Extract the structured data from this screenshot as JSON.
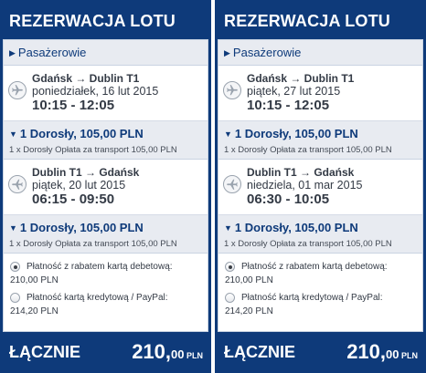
{
  "panels": [
    {
      "header": "REZERWACJA LOTU",
      "passengers_label": "Pasażerowie",
      "outbound": {
        "route": "Gdańsk → Dublin T1",
        "date": "poniedziałek, 16 lut 2015",
        "times": "10:15 - 12:05",
        "fare": "1 Dorosły, 105,00 PLN",
        "fare_detail": "1 x Dorosły Opłata za transport 105,00 PLN"
      },
      "inbound": {
        "route": "Dublin T1 → Gdańsk",
        "date": "piątek, 20 lut 2015",
        "times": "06:15 - 09:50",
        "fare": "1 Dorosły, 105,00 PLN",
        "fare_detail": "1 x Dorosły Opłata za transport 105,00 PLN"
      },
      "payments": [
        {
          "label": "Płatność z rabatem kartą debetową:",
          "amount": "210,00 PLN",
          "selected": true
        },
        {
          "label": "Płatność kartą kredytową / PayPal:",
          "amount": "214,20 PLN",
          "selected": false
        }
      ],
      "total_label": "ŁĄCZNIE",
      "total_int": "210,",
      "total_dec": "00",
      "total_cur": " PLN"
    },
    {
      "header": "REZERWACJA LOTU",
      "passengers_label": "Pasażerowie",
      "outbound": {
        "route": "Gdańsk → Dublin T1",
        "date": "piątek, 27 lut 2015",
        "times": "10:15 - 12:05",
        "fare": "1 Dorosły, 105,00 PLN",
        "fare_detail": "1 x Dorosły Opłata za transport 105,00 PLN"
      },
      "inbound": {
        "route": "Dublin T1 → Gdańsk",
        "date": "niedziela, 01 mar 2015",
        "times": "06:30 - 10:05",
        "fare": "1 Dorosły, 105,00 PLN",
        "fare_detail": "1 x Dorosły Opłata za transport 105,00 PLN"
      },
      "payments": [
        {
          "label": "Płatność z rabatem kartą debetową:",
          "amount": "210,00 PLN",
          "selected": true
        },
        {
          "label": "Płatność kartą kredytową / PayPal:",
          "amount": "214,20 PLN",
          "selected": false
        }
      ],
      "total_label": "ŁĄCZNIE",
      "total_int": "210,",
      "total_dec": "00",
      "total_cur": " PLN"
    }
  ],
  "colors": {
    "brand_navy": "#0e3a7a",
    "section_bg": "#e8ebf1",
    "text": "#333a45"
  },
  "icons": {
    "expand": "triangle-right",
    "collapse": "triangle-down",
    "flight": "airplane-icon",
    "radio": "radio-icon"
  }
}
